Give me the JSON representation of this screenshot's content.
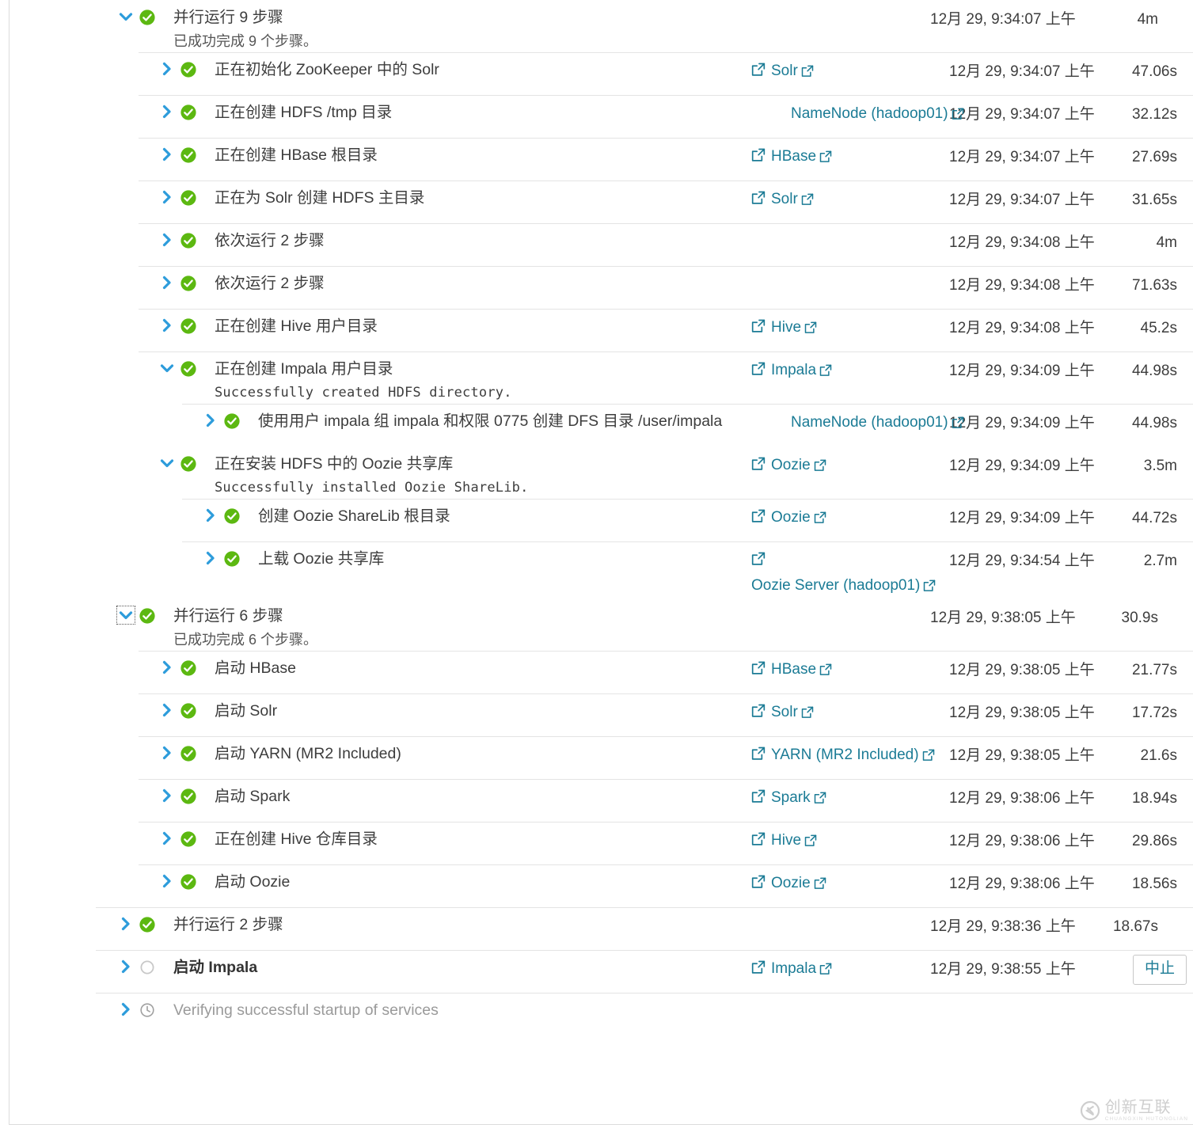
{
  "colors": {
    "chevron": "#2d9cdb",
    "success": "#5cb811",
    "link": "#1b7b95",
    "pending_ring": "#c8c8c8",
    "clock": "#a0a0a0",
    "separator": "#e4e4e4"
  },
  "icons": {
    "chevron_right": "chevron-right-icon",
    "chevron_down": "chevron-down-icon",
    "success": "success-check-icon",
    "pending": "pending-circle-icon",
    "waiting": "clock-icon",
    "external": "external-link-icon"
  },
  "watermark": {
    "main": "创新互联",
    "sub": "CHUANGXIN HUTONGLIAN"
  },
  "rows": [
    {
      "id": "parallel-9",
      "depth": 0,
      "separator": false,
      "expanded": true,
      "status": "success",
      "label": "并行运行 9 步骤",
      "sub": "已成功完成  9  个步骤。",
      "sub_mono": false,
      "service": null,
      "timestamp": "12月 29, 9:34:07 上午",
      "duration": "4m"
    },
    {
      "id": "init-solr-zookeeper",
      "depth": 1,
      "separator": true,
      "expanded": false,
      "status": "success",
      "label": "正在初始化 ZooKeeper 中的 Solr",
      "sub": null,
      "service": {
        "name": "Solr",
        "leading_icon": true
      },
      "timestamp": "12月 29, 9:34:07 上午",
      "duration": "47.06s"
    },
    {
      "id": "create-hdfs-tmp",
      "depth": 1,
      "separator": true,
      "expanded": false,
      "status": "success",
      "label": "正在创建 HDFS /tmp 目录",
      "sub": null,
      "service": {
        "name": "NameNode (hadoop01)",
        "leading_icon": false,
        "wrap": true
      },
      "timestamp": "12月 29, 9:34:07 上午",
      "duration": "32.12s"
    },
    {
      "id": "create-hbase-root",
      "depth": 1,
      "separator": true,
      "expanded": false,
      "status": "success",
      "label": "正在创建 HBase 根目录",
      "sub": null,
      "service": {
        "name": "HBase",
        "leading_icon": true
      },
      "timestamp": "12月 29, 9:34:07 上午",
      "duration": "27.69s"
    },
    {
      "id": "create-solr-hdfs-home",
      "depth": 1,
      "separator": true,
      "expanded": false,
      "status": "success",
      "label": "正在为 Solr 创建 HDFS 主目录",
      "sub": null,
      "service": {
        "name": "Solr",
        "leading_icon": true
      },
      "timestamp": "12月 29, 9:34:07 上午",
      "duration": "31.65s"
    },
    {
      "id": "sequential-2-a",
      "depth": 1,
      "separator": true,
      "expanded": false,
      "status": "success",
      "label": "依次运行 2 步骤",
      "sub": null,
      "service": null,
      "timestamp": "12月 29, 9:34:08 上午",
      "duration": "4m"
    },
    {
      "id": "sequential-2-b",
      "depth": 1,
      "separator": true,
      "expanded": false,
      "status": "success",
      "label": "依次运行 2 步骤",
      "sub": null,
      "service": null,
      "timestamp": "12月 29, 9:34:08 上午",
      "duration": "71.63s"
    },
    {
      "id": "create-hive-user-dir",
      "depth": 1,
      "separator": true,
      "expanded": false,
      "status": "success",
      "label": "正在创建 Hive 用户目录",
      "sub": null,
      "service": {
        "name": "Hive",
        "leading_icon": true
      },
      "timestamp": "12月 29, 9:34:08 上午",
      "duration": "45.2s"
    },
    {
      "id": "create-impala-user-dir",
      "depth": 1,
      "separator": true,
      "expanded": true,
      "status": "success",
      "label": "正在创建 Impala 用户目录",
      "sub": "Successfully created HDFS directory.",
      "sub_mono": true,
      "service": {
        "name": "Impala",
        "leading_icon": true
      },
      "timestamp": "12月 29, 9:34:09 上午",
      "duration": "44.98s"
    },
    {
      "id": "create-dfs-dir-user-impala",
      "depth": 2,
      "separator": true,
      "expanded": false,
      "status": "success",
      "label": "使用用户 impala 组 impala 和权限 0775 创建 DFS 目录 /user/impala",
      "sub": null,
      "service": {
        "name": "NameNode (hadoop01)",
        "leading_icon": false,
        "wrap": true
      },
      "timestamp": "12月 29, 9:34:09 上午",
      "duration": "44.98s"
    },
    {
      "id": "install-oozie-sharelib",
      "depth": 1,
      "separator": false,
      "expanded": true,
      "status": "success",
      "label": "正在安装 HDFS 中的 Oozie 共享库",
      "sub": "Successfully installed Oozie ShareLib.",
      "sub_mono": true,
      "service": {
        "name": "Oozie",
        "leading_icon": true
      },
      "timestamp": "12月 29, 9:34:09 上午",
      "duration": "3.5m"
    },
    {
      "id": "create-oozie-sharelib-root",
      "depth": 2,
      "separator": true,
      "expanded": false,
      "status": "success",
      "label": "创建 Oozie ShareLib 根目录",
      "sub": null,
      "service": {
        "name": "Oozie",
        "leading_icon": true
      },
      "timestamp": "12月 29, 9:34:09 上午",
      "duration": "44.72s"
    },
    {
      "id": "upload-oozie-sharelib",
      "depth": 2,
      "separator": true,
      "expanded": false,
      "status": "success",
      "label": "上载 Oozie 共享库",
      "sub": null,
      "service": {
        "name": "Oozie Server (hadoop01)",
        "leading_icon": true,
        "wrap": true
      },
      "timestamp": "12月 29, 9:34:54 上午",
      "duration": "2.7m"
    },
    {
      "id": "parallel-6",
      "depth": 0,
      "separator": false,
      "expanded": true,
      "focused": true,
      "status": "success",
      "label": "并行运行 6 步骤",
      "sub": "已成功完成  6  个步骤。",
      "sub_mono": false,
      "service": null,
      "timestamp": "12月 29, 9:38:05 上午",
      "duration": "30.9s"
    },
    {
      "id": "start-hbase",
      "depth": 1,
      "separator": true,
      "expanded": false,
      "status": "success",
      "label": "启动 HBase",
      "sub": null,
      "service": {
        "name": "HBase",
        "leading_icon": true
      },
      "timestamp": "12月 29, 9:38:05 上午",
      "duration": "21.77s"
    },
    {
      "id": "start-solr",
      "depth": 1,
      "separator": true,
      "expanded": false,
      "status": "success",
      "label": "启动 Solr",
      "sub": null,
      "service": {
        "name": "Solr",
        "leading_icon": true
      },
      "timestamp": "12月 29, 9:38:05 上午",
      "duration": "17.72s"
    },
    {
      "id": "start-yarn",
      "depth": 1,
      "separator": true,
      "expanded": false,
      "status": "success",
      "label": "启动 YARN (MR2 Included)",
      "sub": null,
      "service": {
        "name": "YARN (MR2 Included)",
        "leading_icon": true
      },
      "timestamp": "12月 29, 9:38:05 上午",
      "duration": "21.6s"
    },
    {
      "id": "start-spark",
      "depth": 1,
      "separator": true,
      "expanded": false,
      "status": "success",
      "label": "启动 Spark",
      "sub": null,
      "service": {
        "name": "Spark",
        "leading_icon": true
      },
      "timestamp": "12月 29, 9:38:06 上午",
      "duration": "18.94s"
    },
    {
      "id": "create-hive-warehouse-dir",
      "depth": 1,
      "separator": true,
      "expanded": false,
      "status": "success",
      "label": "正在创建 Hive 仓库目录",
      "sub": null,
      "service": {
        "name": "Hive",
        "leading_icon": true
      },
      "timestamp": "12月 29, 9:38:06 上午",
      "duration": "29.86s"
    },
    {
      "id": "start-oozie",
      "depth": 1,
      "separator": true,
      "expanded": false,
      "status": "success",
      "label": "启动 Oozie",
      "sub": null,
      "service": {
        "name": "Oozie",
        "leading_icon": true
      },
      "timestamp": "12月 29, 9:38:06 上午",
      "duration": "18.56s"
    },
    {
      "id": "parallel-2",
      "depth": 0,
      "separator": true,
      "expanded": false,
      "status": "success",
      "label": "并行运行 2 步骤",
      "sub": null,
      "service": null,
      "timestamp": "12月 29, 9:38:36 上午",
      "duration": "18.67s"
    },
    {
      "id": "start-impala",
      "depth": 0,
      "separator": true,
      "expanded": false,
      "status": "pending",
      "label": "启动 Impala",
      "bold": true,
      "sub": null,
      "service": {
        "name": "Impala",
        "leading_icon": true,
        "shift": true
      },
      "timestamp": "12月 29, 9:38:55 上午",
      "duration": null,
      "action": "中止"
    },
    {
      "id": "verify-startup",
      "depth": 0,
      "separator": true,
      "expanded": false,
      "status": "waiting",
      "label": "Verifying successful startup of services",
      "muted": true,
      "sub": null,
      "service": null,
      "timestamp": null,
      "duration": null
    }
  ]
}
